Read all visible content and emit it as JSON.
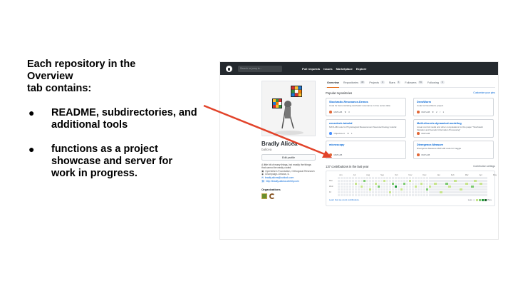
{
  "slide": {
    "heading_lines": [
      "Each repository in the",
      "Overview",
      "tab contains:"
    ],
    "bullets": [
      "README, subdirectories, and additional tools",
      "functions as a project showcase and server for work in progress."
    ]
  },
  "header": {
    "search_placeholder": "Search or jump to...",
    "nav": [
      "Pull requests",
      "Issues",
      "Marketplace",
      "Explore"
    ]
  },
  "profile": {
    "name": "Bradly Alicea",
    "login": "balicea",
    "edit_button": "Edit profile",
    "bio": "A little bit of many things, but mostly the things that cannot be easily coded.",
    "meta": [
      {
        "icon": "org-icon",
        "text": "OpenWorm Foundation, Orthogonal Research"
      },
      {
        "icon": "location-icon",
        "text": "Champaign-Urbana, IL"
      },
      {
        "icon": "mail-icon",
        "text": "bradly.alicea@outlook.com"
      },
      {
        "icon": "link-icon",
        "text": "http://bradly-alicea.weebly.com"
      }
    ],
    "orgs_title": "Organizations"
  },
  "tabs": [
    {
      "label": "Overview",
      "count": ""
    },
    {
      "label": "Repositories",
      "count": "38"
    },
    {
      "label": "Projects",
      "count": "0"
    },
    {
      "label": "Stars",
      "count": "6"
    },
    {
      "label": "Followers",
      "count": "56"
    },
    {
      "label": "Following",
      "count": "6"
    }
  ],
  "popular": {
    "title": "Popular repositories",
    "customize": "Customize your pins"
  },
  "repos": [
    {
      "name": "Stochastic-Resonance-Demos",
      "desc": "Code for demonstrating stochastic resonance in time series data",
      "lang": "MATLAB",
      "lang_color": "#e16737",
      "stars": "3",
      "forks": ""
    },
    {
      "name": "DevoWorm",
      "desc": "Code for DevoWorm project",
      "lang": "MATLAB",
      "lang_color": "#e16737",
      "stars": "2",
      "forks": "1"
    },
    {
      "name": "neurotech-tutorial",
      "desc": "MATLAB code for Physiological Measurement Neurotechnology tutorial",
      "lang": "Objective-C",
      "lang_color": "#438eff",
      "stars": "1",
      "forks": ""
    },
    {
      "name": "Multi-discrete-dynamical-modeling",
      "desc": "Linear control model and other computations for the paper \"Stochastic Variation and Genetic Information Processing\"",
      "lang": "MATLAB",
      "lang_color": "#e16737",
      "stars": "",
      "forks": ""
    },
    {
      "name": "microscopy",
      "desc": "",
      "lang": "MATLAB",
      "lang_color": "#e16737",
      "stars": "",
      "forks": ""
    },
    {
      "name": "Divergence-Measure",
      "desc": "Divergence Measure MATLAB code for Kaggle",
      "lang": "MATLAB",
      "lang_color": "#e16737",
      "stars": "",
      "forks": ""
    }
  ],
  "contributions": {
    "title": "137 contributions in the last year",
    "settings": "Contribution settings",
    "months": [
      "Jun",
      "Jul",
      "Aug",
      "Sep",
      "Oct",
      "Nov",
      "Dec",
      "Jan",
      "Feb",
      "Mar",
      "Apr",
      "May"
    ],
    "days": [
      "Mon",
      "Wed",
      "Fri"
    ],
    "learn_text": "Learn how we count contributions.",
    "less": "Less",
    "more": "More",
    "active_cells": [
      [
        6,
        2,
        1
      ],
      [
        8,
        3,
        1
      ],
      [
        9,
        1,
        2
      ],
      [
        11,
        4,
        1
      ],
      [
        13,
        2,
        1
      ],
      [
        14,
        3,
        2
      ],
      [
        16,
        1,
        1
      ],
      [
        18,
        5,
        1
      ],
      [
        19,
        2,
        2
      ],
      [
        20,
        3,
        3
      ],
      [
        22,
        4,
        1
      ],
      [
        23,
        2,
        2
      ],
      [
        25,
        1,
        1
      ],
      [
        27,
        3,
        1
      ],
      [
        29,
        2,
        1
      ],
      [
        31,
        4,
        2
      ],
      [
        32,
        3,
        1
      ],
      [
        34,
        2,
        1
      ],
      [
        36,
        5,
        1
      ],
      [
        38,
        2,
        2
      ],
      [
        39,
        3,
        1
      ],
      [
        41,
        1,
        1
      ],
      [
        43,
        4,
        1
      ],
      [
        45,
        2,
        1
      ],
      [
        47,
        3,
        2
      ],
      [
        48,
        1,
        1
      ],
      [
        50,
        2,
        1
      ]
    ]
  },
  "colors": {
    "header_bg": "#24292e",
    "link": "#0366d6",
    "arrow": "#e2432a"
  }
}
